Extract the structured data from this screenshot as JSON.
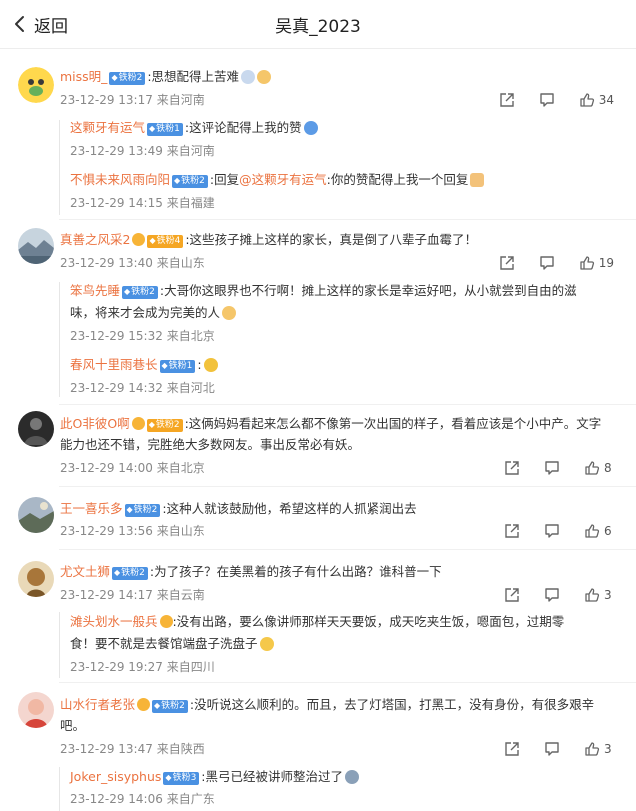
{
  "header": {
    "back_label": "返回",
    "title": "吴真_2023"
  },
  "comments": [
    {
      "user": "miss明_",
      "fan": "铁粉2",
      "text": ":思想配得上苦难",
      "time": "23-12-29 13:17",
      "loc": "来自河南",
      "likes": "34",
      "replies": [
        {
          "user": "这颗牙有运气",
          "fan": "铁粉1",
          "text": ":这评论配得上我的赞",
          "time": "23-12-29 13:49",
          "loc": "来自河南"
        },
        {
          "user": "不惧未来风雨向阳",
          "fan": "铁粉2",
          "pre": ":回复",
          "at": "@这颗牙有运气",
          "text": ":你的赞配得上我一个回复",
          "time": "23-12-29 14:15",
          "loc": "来自福建"
        }
      ]
    },
    {
      "user": "真善之风采2",
      "fan": "铁粉4",
      "text": ":这些孩子摊上这样的家长，真是倒了八辈子血霉了！",
      "time": "23-12-29 13:40",
      "loc": "来自山东",
      "likes": "19",
      "replies": [
        {
          "user": "笨鸟先睡",
          "fan": "铁粉2",
          "text1": ":大哥你这眼界也不行啊！摊上这样的家长是幸运好吧，从小就尝到自由的滋",
          "text2": "味，将来才会成为完美的人",
          "time": "23-12-29 15:32",
          "loc": "来自北京"
        },
        {
          "user": "春风十里雨巷长",
          "fan": "铁粉1",
          "text": ":",
          "time": "23-12-29 14:32",
          "loc": "来自河北"
        }
      ]
    },
    {
      "user": "此O非彼O啊",
      "fan": "铁粉2",
      "text1": ":这俩妈妈看起来怎么都不像第一次出国的样子，看着应该是个小中产。文字",
      "text2": "能力也还不错，完胜绝大多数网友。事出反常必有妖。",
      "time": "23-12-29 14:00",
      "loc": "来自北京",
      "likes": "8"
    },
    {
      "user": "王一喜乐多",
      "fan": "铁粉2",
      "text": ":这种人就该鼓励他，希望这样的人抓紧润出去",
      "time": "23-12-29 13:56",
      "loc": "来自山东",
      "likes": "6"
    },
    {
      "user": "尤文土狮",
      "fan": "铁粉2",
      "text": ":为了孩子？在美黑着的孩子有什么出路？谁科普一下",
      "time": "23-12-29 14:17",
      "loc": "来自云南",
      "likes": "3",
      "replies": [
        {
          "user": "滩头划水一般兵",
          "text1": ":没有出路，要么像讲师那样天天要饭，成天吃夹生饭，嗯面包，过期零",
          "text2": "食！要不就是去餐馆端盘子洗盘子",
          "time": "23-12-29 19:27",
          "loc": "来自四川"
        }
      ]
    },
    {
      "user": "山水行者老张",
      "fan": "铁粉2",
      "text1": ":没听说这么顺利的。而且，去了灯塔国，打黑工，没有身份，有很多艰辛",
      "text2": "吧。",
      "time": "23-12-29 13:47",
      "loc": "来自陕西",
      "likes": "3",
      "replies": [
        {
          "user": "Joker_sisyphus",
          "fan": "铁粉3",
          "text": ":黑弓已经被讲师整治过了",
          "time": "23-12-29 14:06",
          "loc": "来自广东"
        }
      ]
    }
  ],
  "colors": {
    "username": "#eb7340",
    "badge": "#4a91e2",
    "meta": "#888888"
  },
  "icons": [
    "back-arrow-icon",
    "share-icon",
    "comment-icon",
    "like-icon"
  ]
}
